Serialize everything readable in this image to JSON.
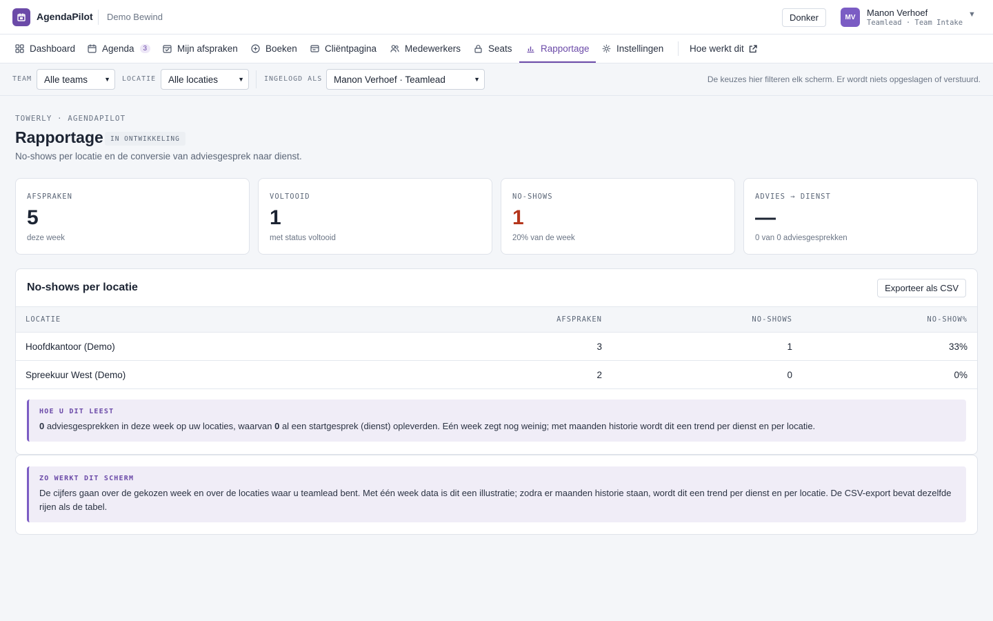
{
  "app": {
    "name": "AgendaPilot",
    "tenant": "Demo Bewind"
  },
  "header": {
    "theme_label": "Donker",
    "user": {
      "initials": "MV",
      "name": "Manon Verhoef",
      "role": "Teamlead · Team Intake"
    }
  },
  "nav": {
    "items": [
      {
        "label": "Dashboard",
        "icon": "grid-icon"
      },
      {
        "label": "Agenda",
        "icon": "calendar-icon",
        "badge": "3"
      },
      {
        "label": "Mijn afspraken",
        "icon": "calendar-check-icon"
      },
      {
        "label": "Boeken",
        "icon": "plus-circle-icon"
      },
      {
        "label": "Cliëntpagina",
        "icon": "window-icon"
      },
      {
        "label": "Medewerkers",
        "icon": "users-icon"
      },
      {
        "label": "Seats",
        "icon": "lock-icon"
      },
      {
        "label": "Rapportage",
        "icon": "bar-chart-icon",
        "active": true
      },
      {
        "label": "Instellingen",
        "icon": "gear-icon"
      }
    ],
    "help_label": "Hoe werkt dit"
  },
  "filters": {
    "team_label": "TEAM",
    "team_value": "Alle teams",
    "location_label": "LOCATIE",
    "location_value": "Alle locaties",
    "login_label": "INGELOGD ALS",
    "login_value": "Manon Verhoef · Teamlead",
    "hint": "De keuzes hier filteren elk scherm. Er wordt niets opgeslagen of verstuurd."
  },
  "page": {
    "breadcrumb": "TOWERLY · AGENDAPILOT",
    "title": "Rapportage",
    "status": "IN ONTWIKKELING",
    "subtitle": "No-shows per locatie en de conversie van adviesgesprek naar dienst."
  },
  "kpis": [
    {
      "label": "AFSPRAKEN",
      "value": "5",
      "sub": "deze week",
      "accent": "#1c2433"
    },
    {
      "label": "VOLTOOID",
      "value": "1",
      "sub": "met status voltooid",
      "accent": "#1c2433"
    },
    {
      "label": "NO-SHOWS",
      "value": "1",
      "sub": "20% van de week",
      "accent": "#b5361c"
    },
    {
      "label": "ADVIES → DIENST",
      "value": "—",
      "sub": "0 van 0 adviesgesprekken",
      "accent": "#1c2433"
    }
  ],
  "noshow_table": {
    "title": "No-shows per locatie",
    "export_label": "Exporteer als CSV",
    "columns": [
      "LOCATIE",
      "AFSPRAKEN",
      "NO-SHOWS",
      "NO-SHOW%"
    ],
    "rows": [
      [
        "Hoofdkantoor (Demo)",
        "3",
        "1",
        "33%"
      ],
      [
        "Spreekuur West (Demo)",
        "2",
        "0",
        "0%"
      ]
    ],
    "note": {
      "title": "HOE U DIT LEEST",
      "n_advies": "0",
      "text_1": " adviesgesprekken in deze week op uw locaties, waarvan ",
      "n_start": "0",
      "text_2": " al een startgesprek (dienst) opleverden. Eén week zegt nog weinig; met maanden historie wordt dit een trend per dienst en per locatie."
    }
  },
  "explainer": {
    "title": "ZO WERKT DIT SCHERM",
    "text": "De cijfers gaan over de gekozen week en over de locaties waar u teamlead bent. Met één week data is dit een illustratie; zodra er maanden historie staan, wordt dit een trend per dienst en per locatie. De CSV-export bevat dezelfde rijen als de tabel."
  },
  "colors": {
    "brand": "#6b4aa8",
    "danger": "#b5361c",
    "note_bg": "#f0edf7"
  }
}
